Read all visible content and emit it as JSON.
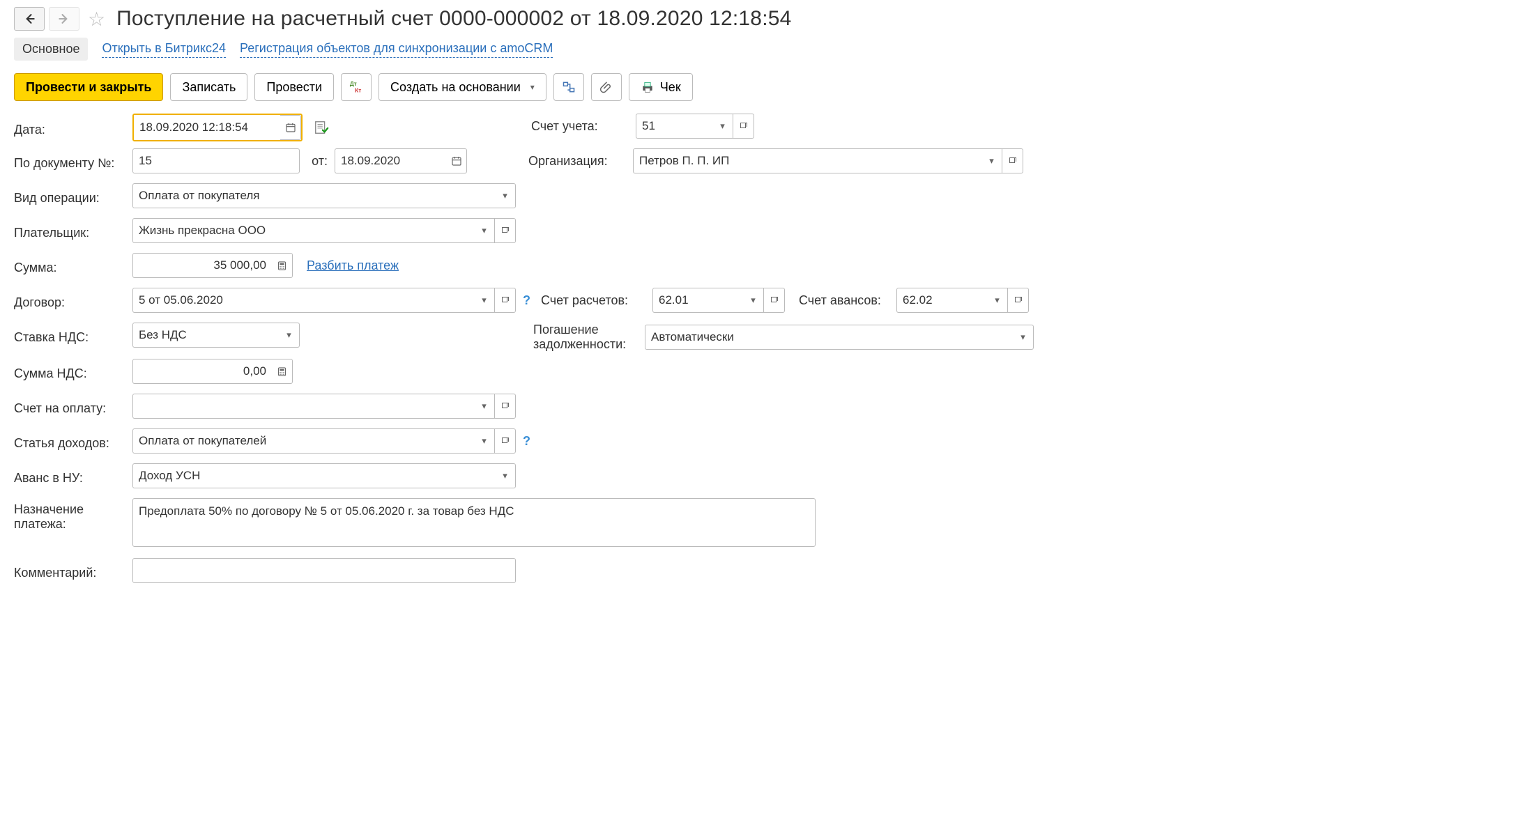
{
  "header": {
    "title": "Поступление на расчетный счет 0000-000002 от 18.09.2020 12:18:54"
  },
  "tabs": {
    "main": "Основное",
    "bitrix": "Открыть в Битрикс24",
    "amocrm": "Регистрация объектов для синхронизации с amoCRM"
  },
  "toolbar": {
    "post_close": "Провести и закрыть",
    "save": "Записать",
    "post": "Провести",
    "create_based": "Создать на основании",
    "check": "Чек"
  },
  "labels": {
    "date": "Дата:",
    "doc_no": "По документу №:",
    "ot": "от:",
    "op_type": "Вид операции:",
    "payer": "Плательщик:",
    "sum": "Сумма:",
    "split": "Разбить платеж",
    "contract": "Договор:",
    "vat_rate": "Ставка НДС:",
    "vat_sum": "Сумма НДС:",
    "invoice": "Счет на оплату:",
    "income_item": "Статья доходов:",
    "advance_nu": "Аванс в НУ:",
    "purpose1": "Назначение",
    "purpose2": "платежа:",
    "comment": "Комментарий:",
    "account": "Счет учета:",
    "org": "Организация:",
    "settlement_acc": "Счет расчетов:",
    "advance_acc": "Счет авансов:",
    "debt_repay1": "Погашение",
    "debt_repay2": "задолженности:"
  },
  "values": {
    "date": "18.09.2020 12:18:54",
    "doc_no": "15",
    "doc_date": "18.09.2020",
    "op_type": "Оплата от покупателя",
    "payer": "Жизнь прекрасна ООО",
    "sum": "35 000,00",
    "contract": "5 от 05.06.2020",
    "vat_rate": "Без НДС",
    "vat_sum": "0,00",
    "invoice": "",
    "income_item": "Оплата от покупателей",
    "advance_nu": "Доход УСН",
    "purpose": "Предоплата 50% по договору № 5 от 05.06.2020 г. за товар без НДС",
    "comment": "",
    "account": "51",
    "org": "Петров П. П. ИП",
    "settlement_acc": "62.01",
    "advance_acc": "62.02",
    "debt_repay": "Автоматически"
  }
}
